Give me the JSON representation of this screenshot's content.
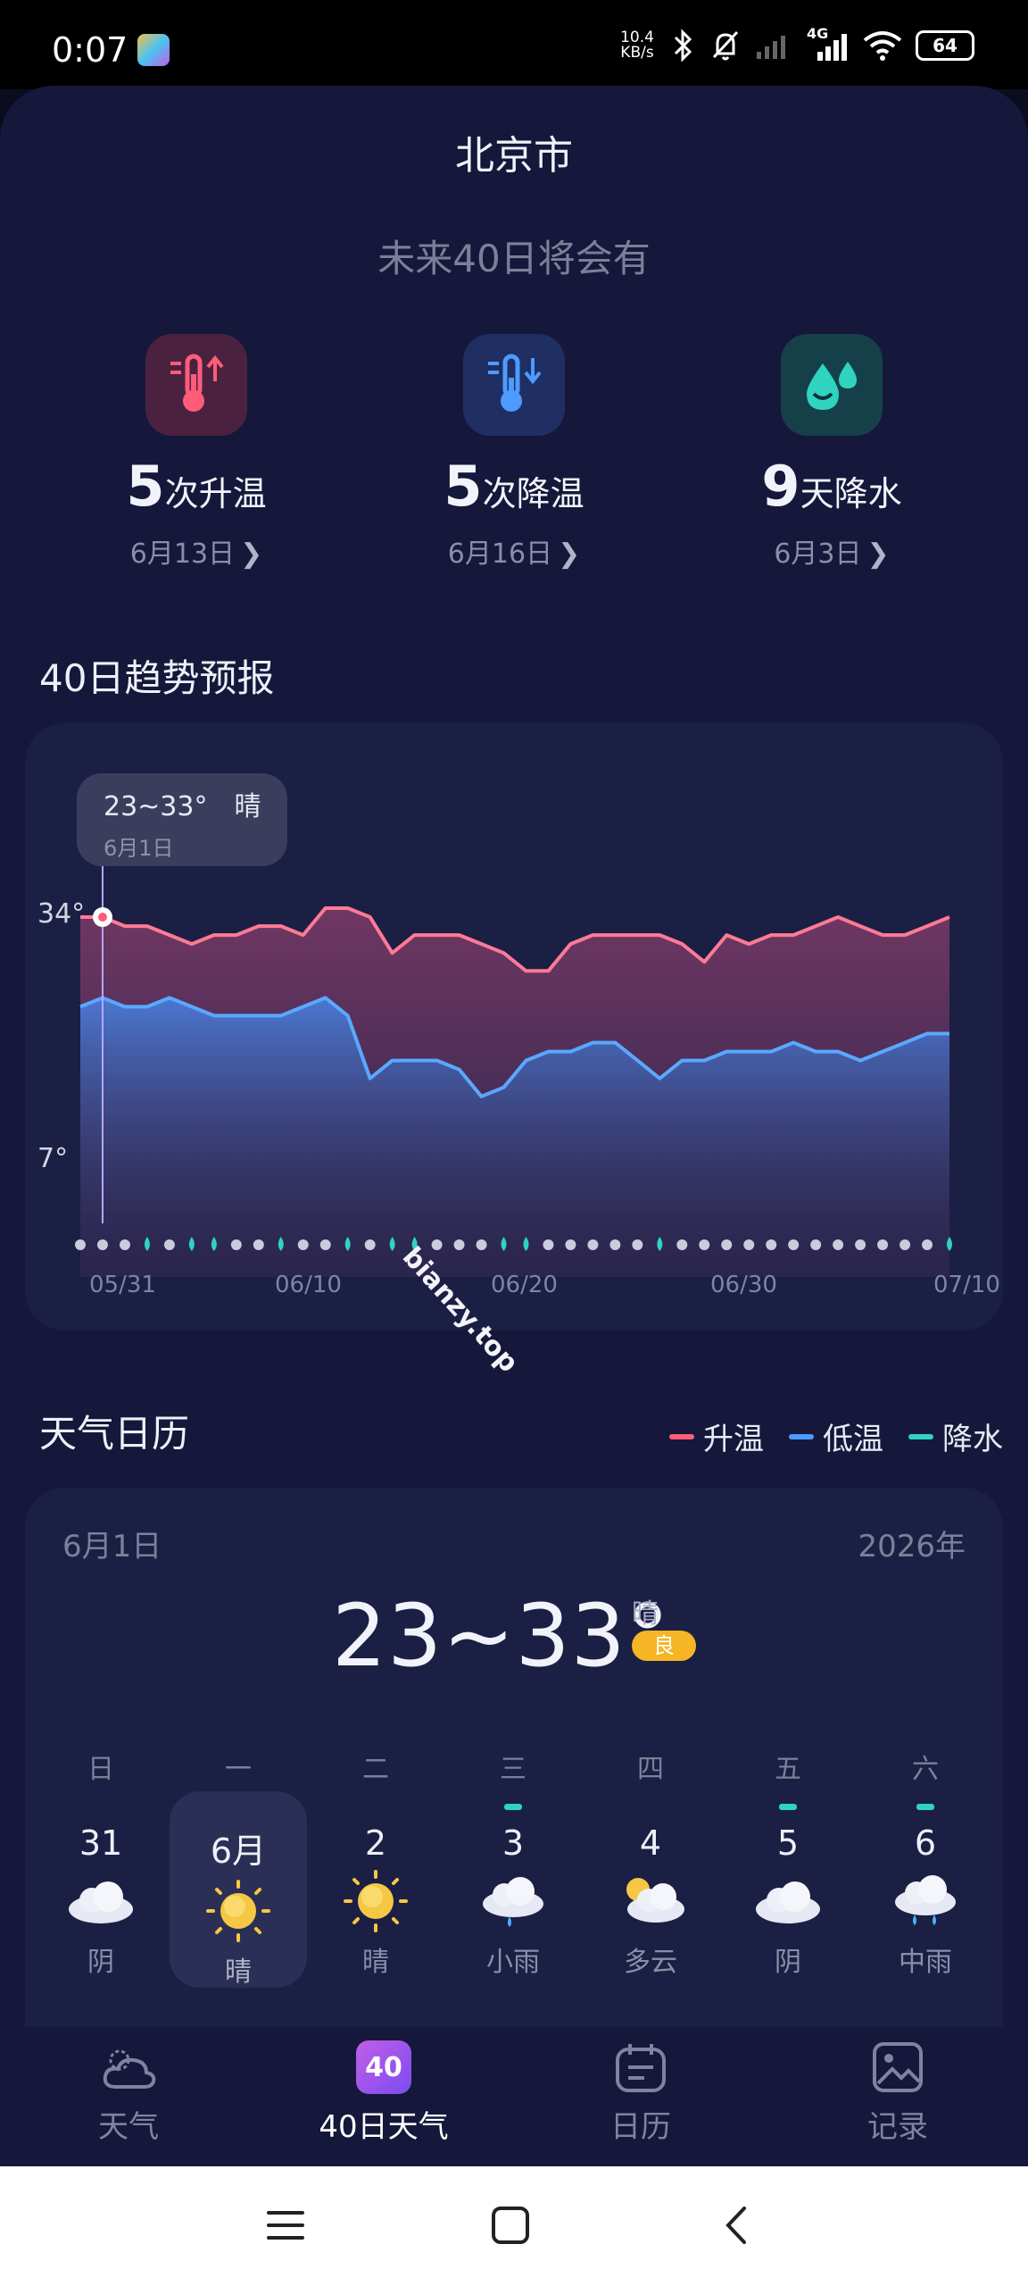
{
  "status_bar": {
    "time": "0:07",
    "speed_value": "10.4",
    "speed_unit": "KB/s",
    "network": "4G",
    "battery": "64"
  },
  "header": {
    "city": "北京市",
    "subtitle": "未来40日将会有"
  },
  "stats": [
    {
      "count": "5",
      "label": "次升温",
      "date": "6月13日",
      "icon": "thermometer-up-icon",
      "color": "#ff5c7a"
    },
    {
      "count": "5",
      "label": "次降温",
      "date": "6月16日",
      "icon": "thermometer-down-icon",
      "color": "#4d9bff"
    },
    {
      "count": "9",
      "label": "天降水",
      "date": "6月3日",
      "icon": "water-drops-icon",
      "color": "#2fd3c0"
    }
  ],
  "trend": {
    "title": "40日趋势预报",
    "tooltip": {
      "temp": "23~33°",
      "weather": "晴",
      "date": "6月1日"
    }
  },
  "chart_data": {
    "type": "area",
    "y_tick_labels": [
      "34°",
      "7°"
    ],
    "x_tick_labels": [
      "05/31",
      "06/10",
      "06/20",
      "06/30",
      "07/10"
    ],
    "series": [
      {
        "name": "升温",
        "color": "#ff7a95",
        "values": [
          33,
          33,
          32,
          32,
          31,
          30,
          31,
          31,
          32,
          32,
          31,
          34,
          34,
          33,
          29,
          31,
          31,
          31,
          30,
          29,
          27,
          27,
          30,
          31,
          31,
          31,
          31,
          30,
          28,
          31,
          30,
          31,
          31,
          32,
          33,
          32,
          31,
          31,
          32,
          33
        ]
      },
      {
        "name": "低温",
        "color": "#5aa8ff",
        "values": [
          23,
          24,
          23,
          23,
          24,
          23,
          22,
          22,
          22,
          22,
          23,
          24,
          22,
          15,
          17,
          17,
          17,
          16,
          13,
          14,
          17,
          18,
          18,
          19,
          19,
          17,
          15,
          17,
          17,
          18,
          18,
          18,
          19,
          18,
          18,
          17,
          18,
          19,
          20,
          20
        ]
      },
      {
        "name": "降水",
        "color": "#2fd3c0",
        "days_with_rain": [
          3,
          5,
          6,
          9,
          12,
          14,
          15,
          19,
          20,
          26,
          39
        ]
      }
    ],
    "legend": "top-right",
    "highlighted_day": 1
  },
  "calendar": {
    "title": "天气日历",
    "legend": [
      {
        "label": "升温",
        "color": "#ff5c7a"
      },
      {
        "label": "低温",
        "color": "#4d9bff"
      },
      {
        "label": "降水",
        "color": "#2fd3c0"
      }
    ],
    "selected_date": "6月1日",
    "year": "2026年",
    "temp_range": "23~33°",
    "weather": "晴",
    "aqi": "良",
    "weekdays": [
      "日",
      "一",
      "二",
      "三",
      "四",
      "五",
      "六"
    ],
    "days": [
      {
        "num": "31",
        "desc": "阴",
        "icon": "cloud-icon",
        "rain": false,
        "selected": false
      },
      {
        "num": "6月",
        "desc": "晴",
        "icon": "sun-icon",
        "rain": false,
        "selected": true
      },
      {
        "num": "2",
        "desc": "晴",
        "icon": "sun-icon",
        "rain": false,
        "selected": false
      },
      {
        "num": "3",
        "desc": "小雨",
        "icon": "light-rain-icon",
        "rain": true,
        "selected": false
      },
      {
        "num": "4",
        "desc": "多云",
        "icon": "partly-cloudy-icon",
        "rain": false,
        "selected": false
      },
      {
        "num": "5",
        "desc": "阴",
        "icon": "cloud-icon",
        "rain": true,
        "selected": false
      },
      {
        "num": "6",
        "desc": "中雨",
        "icon": "moderate-rain-icon",
        "rain": true,
        "selected": false
      }
    ]
  },
  "watermark": "bianzy.top",
  "bottom_nav": [
    {
      "label": "天气",
      "icon": "weather-icon",
      "active": false
    },
    {
      "label": "40日天气",
      "icon": "forty-day-icon",
      "badge": "40",
      "active": true
    },
    {
      "label": "日历",
      "icon": "calendar-icon",
      "active": false
    },
    {
      "label": "记录",
      "icon": "gallery-icon",
      "active": false
    }
  ]
}
